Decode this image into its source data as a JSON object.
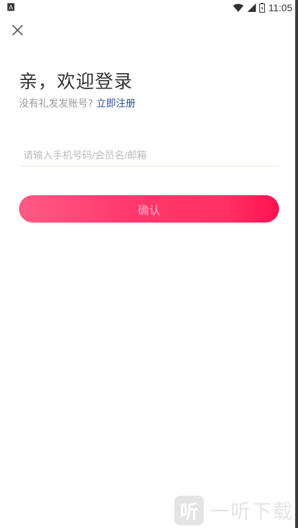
{
  "status_bar": {
    "time": "11:05",
    "left_icon": "notification-a-icon",
    "right_icons": [
      "wifi-icon",
      "signal-icon",
      "battery-icon"
    ]
  },
  "header": {
    "close_icon": "close-icon"
  },
  "main": {
    "title": "亲，欢迎登录",
    "subtitle_text": "没有礼发发账号?",
    "register_link": "立即注册",
    "account_input": {
      "value": "",
      "placeholder": "请输入手机号码/会员名/邮箱"
    },
    "confirm_button": "确认"
  },
  "watermark": {
    "logo_glyph": "听",
    "text": "一听下载"
  },
  "colors": {
    "accent_start": "#ff5a85",
    "accent_end": "#ff1152",
    "link": "#2b4f9e"
  }
}
